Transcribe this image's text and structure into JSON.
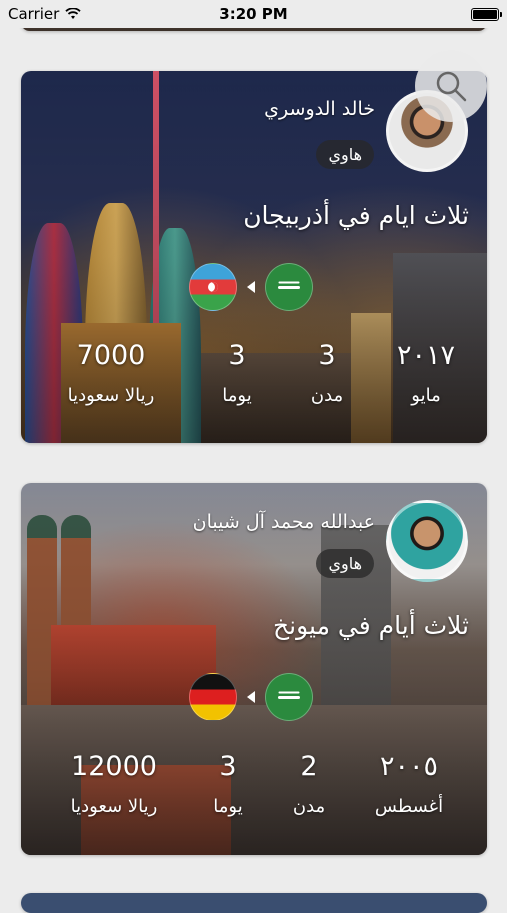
{
  "status": {
    "carrier": "Carrier",
    "time": "3:20 PM"
  },
  "trips": [
    {
      "author": "خالد الدوسري",
      "badge": "هاوي",
      "title": "ثلاث ايام في أذربيجان",
      "from_flag": "saudi-arabia-flag",
      "to_flag": "azerbaijan-flag",
      "stats": [
        {
          "value": "٢٠١٧",
          "label": "مايو"
        },
        {
          "value": "3",
          "label": "مدن"
        },
        {
          "value": "3",
          "label": "يوما"
        },
        {
          "value": "7000",
          "label": "ريالا سعوديا"
        }
      ]
    },
    {
      "author": "عبدالله محمد آل شيبان",
      "badge": "هاوي",
      "title": "ثلاث أيام في ميونخ",
      "from_flag": "saudi-arabia-flag",
      "to_flag": "germany-flag",
      "stats": [
        {
          "value": "٢٠٠٥",
          "label": "أغسطس"
        },
        {
          "value": "2",
          "label": "مدن"
        },
        {
          "value": "3",
          "label": "يوما"
        },
        {
          "value": "12000",
          "label": "ريالا سعوديا"
        }
      ]
    }
  ],
  "icons": {
    "search": "search-icon",
    "wifi": "wifi-icon",
    "battery": "battery-icon"
  }
}
